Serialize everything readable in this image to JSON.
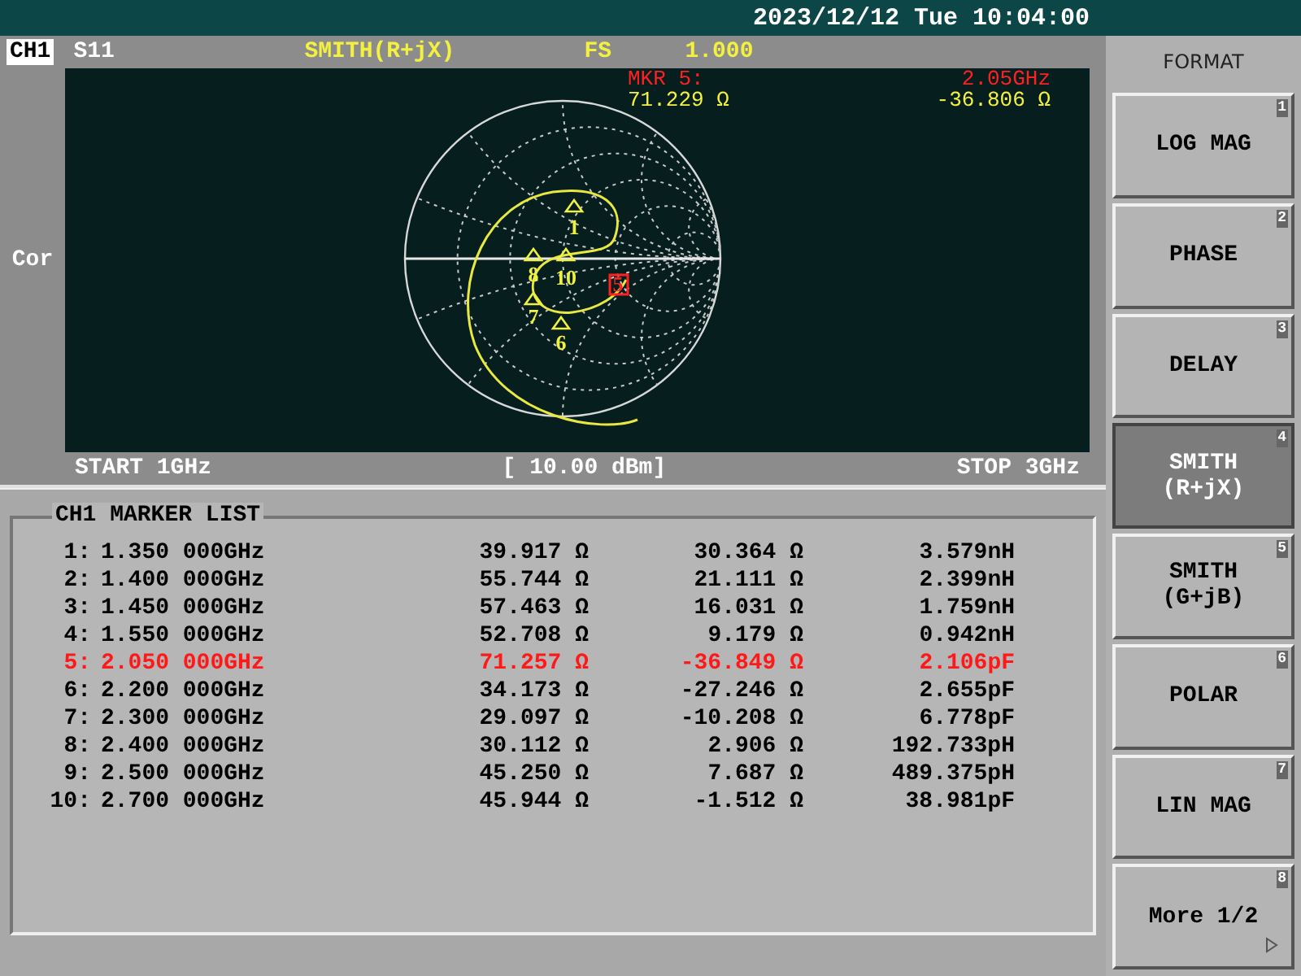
{
  "status_bar": {
    "datetime": "2023/12/12 Tue 10:04:00"
  },
  "channel": {
    "id": "CH1",
    "parameter": "S11",
    "format": "SMITH(R+jX)",
    "scale_label": "FS",
    "scale_value": "1.000",
    "side_label": "Cor"
  },
  "marker_readout": {
    "name": "MKR 5:",
    "frequency": "2.05GHz",
    "resistance": "71.229 Ω",
    "reactance": "-36.806 Ω"
  },
  "smith_markers": [
    {
      "label": "1",
      "selected": false
    },
    {
      "label": "5",
      "selected": true
    },
    {
      "label": "6",
      "selected": false
    },
    {
      "label": "7",
      "selected": false
    },
    {
      "label": "8",
      "selected": false
    },
    {
      "label": "10",
      "selected": false
    }
  ],
  "sweep": {
    "start": "START 1GHz",
    "power": "[ 10.00 dBm]",
    "stop": "STOP 3GHz"
  },
  "marker_list": {
    "title": "CH1 MARKER LIST",
    "rows": [
      {
        "marker": "1:",
        "frequency": "1.350 000GHz",
        "resistance": "39.917 Ω",
        "reactance": "30.364 Ω",
        "equivalent": "3.579nH",
        "selected": false
      },
      {
        "marker": "2:",
        "frequency": "1.400 000GHz",
        "resistance": "55.744 Ω",
        "reactance": "21.111 Ω",
        "equivalent": "2.399nH",
        "selected": false
      },
      {
        "marker": "3:",
        "frequency": "1.450 000GHz",
        "resistance": "57.463 Ω",
        "reactance": "16.031 Ω",
        "equivalent": "1.759nH",
        "selected": false
      },
      {
        "marker": "4:",
        "frequency": "1.550 000GHz",
        "resistance": "52.708 Ω",
        "reactance": "9.179 Ω",
        "equivalent": "0.942nH",
        "selected": false
      },
      {
        "marker": "5:",
        "frequency": "2.050 000GHz",
        "resistance": "71.257 Ω",
        "reactance": "-36.849 Ω",
        "equivalent": "2.106pF",
        "selected": true
      },
      {
        "marker": "6:",
        "frequency": "2.200 000GHz",
        "resistance": "34.173 Ω",
        "reactance": "-27.246 Ω",
        "equivalent": "2.655pF",
        "selected": false
      },
      {
        "marker": "7:",
        "frequency": "2.300 000GHz",
        "resistance": "29.097 Ω",
        "reactance": "-10.208 Ω",
        "equivalent": "6.778pF",
        "selected": false
      },
      {
        "marker": "8:",
        "frequency": "2.400 000GHz",
        "resistance": "30.112 Ω",
        "reactance": "2.906 Ω",
        "equivalent": "192.733pH",
        "selected": false
      },
      {
        "marker": "9:",
        "frequency": "2.500 000GHz",
        "resistance": "45.250 Ω",
        "reactance": "7.687 Ω",
        "equivalent": "489.375pH",
        "selected": false
      },
      {
        "marker": "10:",
        "frequency": "2.700 000GHz",
        "resistance": "45.944 Ω",
        "reactance": "-1.512 Ω",
        "equivalent": "38.981pF",
        "selected": false
      }
    ]
  },
  "softkeys": {
    "title": "FORMAT",
    "keys": [
      {
        "lines": [
          "LOG MAG"
        ],
        "number": "1",
        "selected": false
      },
      {
        "lines": [
          "PHASE"
        ],
        "number": "2",
        "selected": false
      },
      {
        "lines": [
          "DELAY"
        ],
        "number": "3",
        "selected": false
      },
      {
        "lines": [
          "SMITH",
          "(R+jX)"
        ],
        "number": "4",
        "selected": true
      },
      {
        "lines": [
          "SMITH",
          "(G+jB)"
        ],
        "number": "5",
        "selected": false
      },
      {
        "lines": [
          "POLAR"
        ],
        "number": "6",
        "selected": false
      },
      {
        "lines": [
          "LIN MAG"
        ],
        "number": "7",
        "selected": false
      },
      {
        "lines": [
          "More 1/2"
        ],
        "number": "8",
        "selected": false,
        "kind": "more"
      }
    ]
  }
}
